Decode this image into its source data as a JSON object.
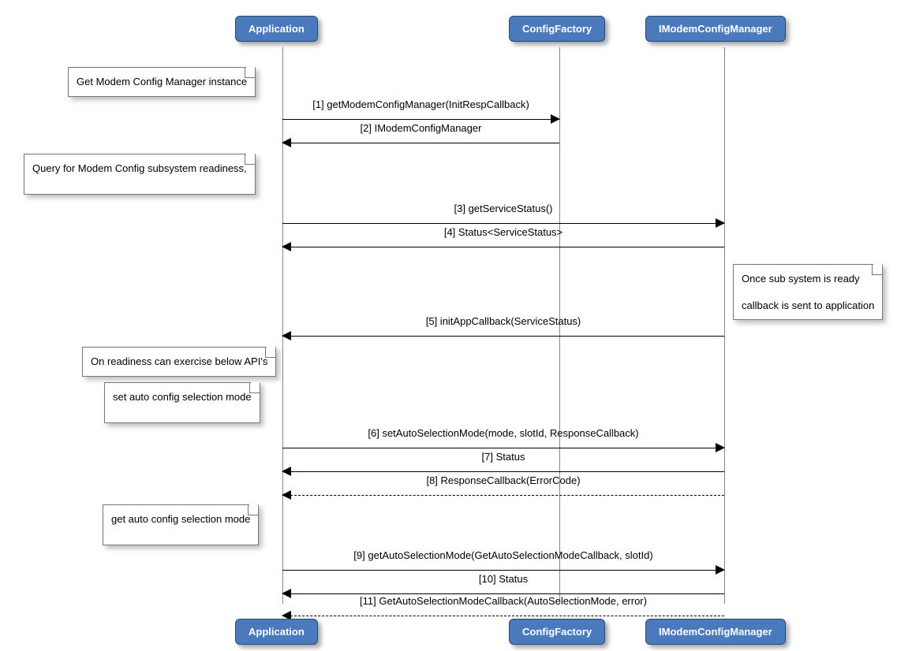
{
  "participants": {
    "application": "Application",
    "configFactory": "ConfigFactory",
    "modemMgr": "IModemConfigManager"
  },
  "notes": {
    "n1": "Get Modem Config Manager instance",
    "n2": "Query for Modem Config subsystem readiness,",
    "n3a": "Once sub system is ready",
    "n3b": "callback is sent to application",
    "n4": "On readiness can exercise below API's",
    "n5": "set auto config selection mode",
    "n6": "get auto config selection mode"
  },
  "messages": {
    "m1": "[1] getModemConfigManager(InitRespCallback)",
    "m2": "[2] IModemConfigManager",
    "m3": "[3] getServiceStatus()",
    "m4": "[4] Status<ServiceStatus>",
    "m5": "[5] initAppCallback(ServiceStatus)",
    "m6": "[6] setAutoSelectionMode(mode, slotId, ResponseCallback)",
    "m7": "[7] Status",
    "m8": "[8] ResponseCallback(ErrorCode)",
    "m9": "[9] getAutoSelectionMode(GetAutoSelectionModeCallback, slotId)",
    "m10": "[10] Status",
    "m11": "[11] GetAutoSelectionModeCallback(AutoSelectionMode, error)"
  },
  "chart_data": {
    "type": "sequence_diagram",
    "participants": [
      "Application",
      "ConfigFactory",
      "IModemConfigManager"
    ],
    "notes": [
      {
        "attached_to": "Application",
        "text": "Get Modem Config Manager instance",
        "before_step": 1
      },
      {
        "attached_to": "Application",
        "text": "Query for Modem Config subsystem readiness,",
        "before_step": 3
      },
      {
        "attached_to": "IModemConfigManager",
        "text": "Once sub system is ready callback is sent to application",
        "before_step": 5
      },
      {
        "attached_to": "Application",
        "text": "On readiness can exercise below API's",
        "before_step": 6
      },
      {
        "attached_to": "Application",
        "text": "set auto config selection mode",
        "before_step": 6
      },
      {
        "attached_to": "Application",
        "text": "get auto config selection mode",
        "before_step": 9
      }
    ],
    "messages": [
      {
        "step": 1,
        "from": "Application",
        "to": "ConfigFactory",
        "label": "getModemConfigManager(InitRespCallback)",
        "style": "solid"
      },
      {
        "step": 2,
        "from": "ConfigFactory",
        "to": "Application",
        "label": "IModemConfigManager",
        "style": "solid"
      },
      {
        "step": 3,
        "from": "Application",
        "to": "IModemConfigManager",
        "label": "getServiceStatus()",
        "style": "solid"
      },
      {
        "step": 4,
        "from": "IModemConfigManager",
        "to": "Application",
        "label": "Status<ServiceStatus>",
        "style": "solid"
      },
      {
        "step": 5,
        "from": "IModemConfigManager",
        "to": "Application",
        "label": "initAppCallback(ServiceStatus)",
        "style": "solid"
      },
      {
        "step": 6,
        "from": "Application",
        "to": "IModemConfigManager",
        "label": "setAutoSelectionMode(mode, slotId, ResponseCallback)",
        "style": "solid"
      },
      {
        "step": 7,
        "from": "IModemConfigManager",
        "to": "Application",
        "label": "Status",
        "style": "solid"
      },
      {
        "step": 8,
        "from": "IModemConfigManager",
        "to": "Application",
        "label": "ResponseCallback(ErrorCode)",
        "style": "dashed"
      },
      {
        "step": 9,
        "from": "Application",
        "to": "IModemConfigManager",
        "label": "getAutoSelectionMode(GetAutoSelectionModeCallback, slotId)",
        "style": "solid"
      },
      {
        "step": 10,
        "from": "IModemConfigManager",
        "to": "Application",
        "label": "Status",
        "style": "solid"
      },
      {
        "step": 11,
        "from": "IModemConfigManager",
        "to": "Application",
        "label": "GetAutoSelectionModeCallback(AutoSelectionMode, error)",
        "style": "dashed"
      }
    ]
  }
}
